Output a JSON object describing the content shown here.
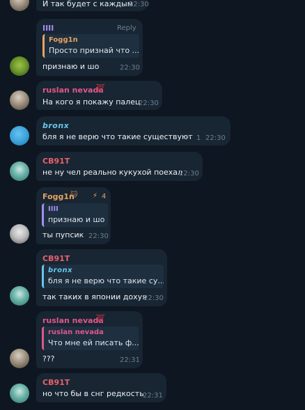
{
  "messages": [
    {
      "text": "И так будет с каждым",
      "time": "22:30"
    },
    {
      "sender": "IIII",
      "reply_label": "Reply",
      "reply_to": {
        "name": "Fogg1n",
        "text": "Просто признай что ..."
      },
      "text": "признаю и шо",
      "time": "22:30"
    },
    {
      "sender": "ruslan nevada",
      "text": "На кого я покажу палец",
      "time": "22:30"
    },
    {
      "sender": "bronx",
      "text": "бля я не верю что такие существуют",
      "replies_count": "1",
      "time": "22:30"
    },
    {
      "sender": "CB91T",
      "text": "не ну чел реально кукухой поехал",
      "time": "22:30"
    },
    {
      "sender": "Fogg1n",
      "badge": "4",
      "reply_to": {
        "name": "IIII",
        "text": "признаю и шо"
      },
      "text": "ты пупсик",
      "time": "22:30"
    },
    {
      "sender": "CB91T",
      "reply_to": {
        "name": "bronx",
        "text": "бля я не верю что такие су..."
      },
      "text": "так таких в японии дохуя",
      "time": "22:30"
    },
    {
      "sender": "ruslan nevada",
      "reply_to": {
        "name": "ruslan nevada",
        "text": "Что мне ей писать ф..."
      },
      "text": "???",
      "time": "22:31"
    },
    {
      "sender": "CB91T",
      "text": "но что бы в снг редкость",
      "time": "22:31"
    }
  ],
  "colors": {
    "background": "#0e1621",
    "bubble": "#182533",
    "name_ruslan": "#e2578a",
    "name_cb91t": "#e8616d",
    "name_bronx": "#67c7e8",
    "name_fogg1n": "#e8a35e",
    "name_iiii": "#a58df0"
  },
  "icons": [
    "reply-arrow-icon",
    "lightning-icon",
    "cat-emoji-icon",
    "japanese-flag-icon"
  ]
}
